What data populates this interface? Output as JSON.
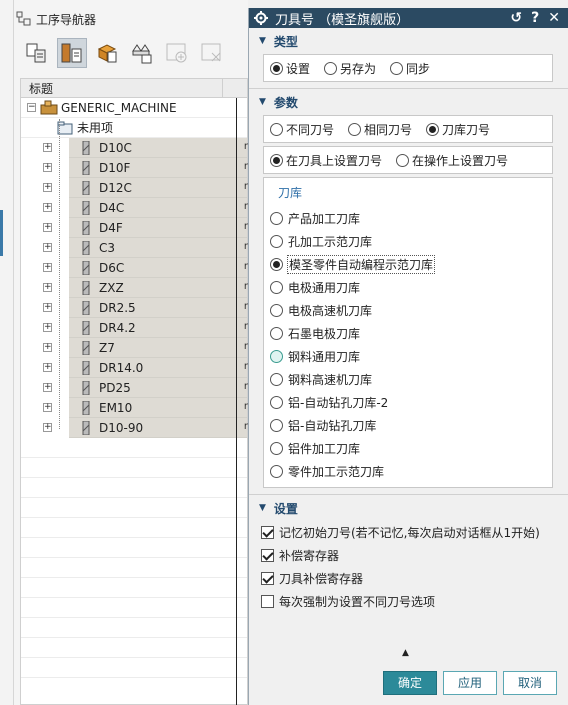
{
  "navigator": {
    "title": "工序导航器",
    "tree_header": "标题",
    "root": "GENERIC_MACHINE",
    "unused": "未用项",
    "tools": [
      "D10C",
      "D10F",
      "D12C",
      "D4C",
      "D4F",
      "C3",
      "D6C",
      "ZXZ",
      "DR2.5",
      "DR4.2",
      "Z7",
      "DR14.0",
      "PD25",
      "EM10",
      "D10-90"
    ],
    "tool_suffix": "r",
    "toolbar_icons": [
      "program-order-view-icon",
      "machine-tool-view-icon",
      "geometry-view-icon",
      "method-view-icon",
      "add-icon",
      "delete-icon"
    ]
  },
  "dialog": {
    "title": "刀具号  （模圣旗舰版）",
    "controls": {
      "reset": "↺",
      "help": "?",
      "close": "✕"
    },
    "type_section": {
      "label": "类型",
      "options": [
        "设置",
        "另存为",
        "同步"
      ],
      "selected": 0
    },
    "params_section": {
      "label": "参数",
      "mode_options": [
        "不同刀号",
        "相同刀号",
        "刀库刀号"
      ],
      "mode_selected": 2,
      "where_options": [
        "在刀具上设置刀号",
        "在操作上设置刀号"
      ],
      "where_selected": 0,
      "library_title": "刀库",
      "libraries": [
        "产品加工刀库",
        "孔加工示范刀库",
        "模圣零件自动编程示范刀库",
        "电极通用刀库",
        "电极高速机刀库",
        "石墨电极刀库",
        "钢料通用刀库",
        "钢料高速机刀库",
        "铝-自动钻孔刀库-2",
        "铝-自动钻孔刀库",
        "铝件加工刀库",
        "零件加工示范刀库"
      ],
      "library_selected": 2,
      "library_hover": 6
    },
    "settings_section": {
      "label": "设置",
      "checks": [
        {
          "label": "记忆初始刀号(若不记忆,每次启动对话框从1开始)",
          "checked": true
        },
        {
          "label": "补偿寄存器",
          "checked": true
        },
        {
          "label": "刀具补偿寄存器",
          "checked": true
        },
        {
          "label": "每次强制为设置不同刀号选项",
          "checked": false
        }
      ]
    },
    "buttons": {
      "ok": "确定",
      "apply": "应用",
      "cancel": "取消"
    }
  }
}
